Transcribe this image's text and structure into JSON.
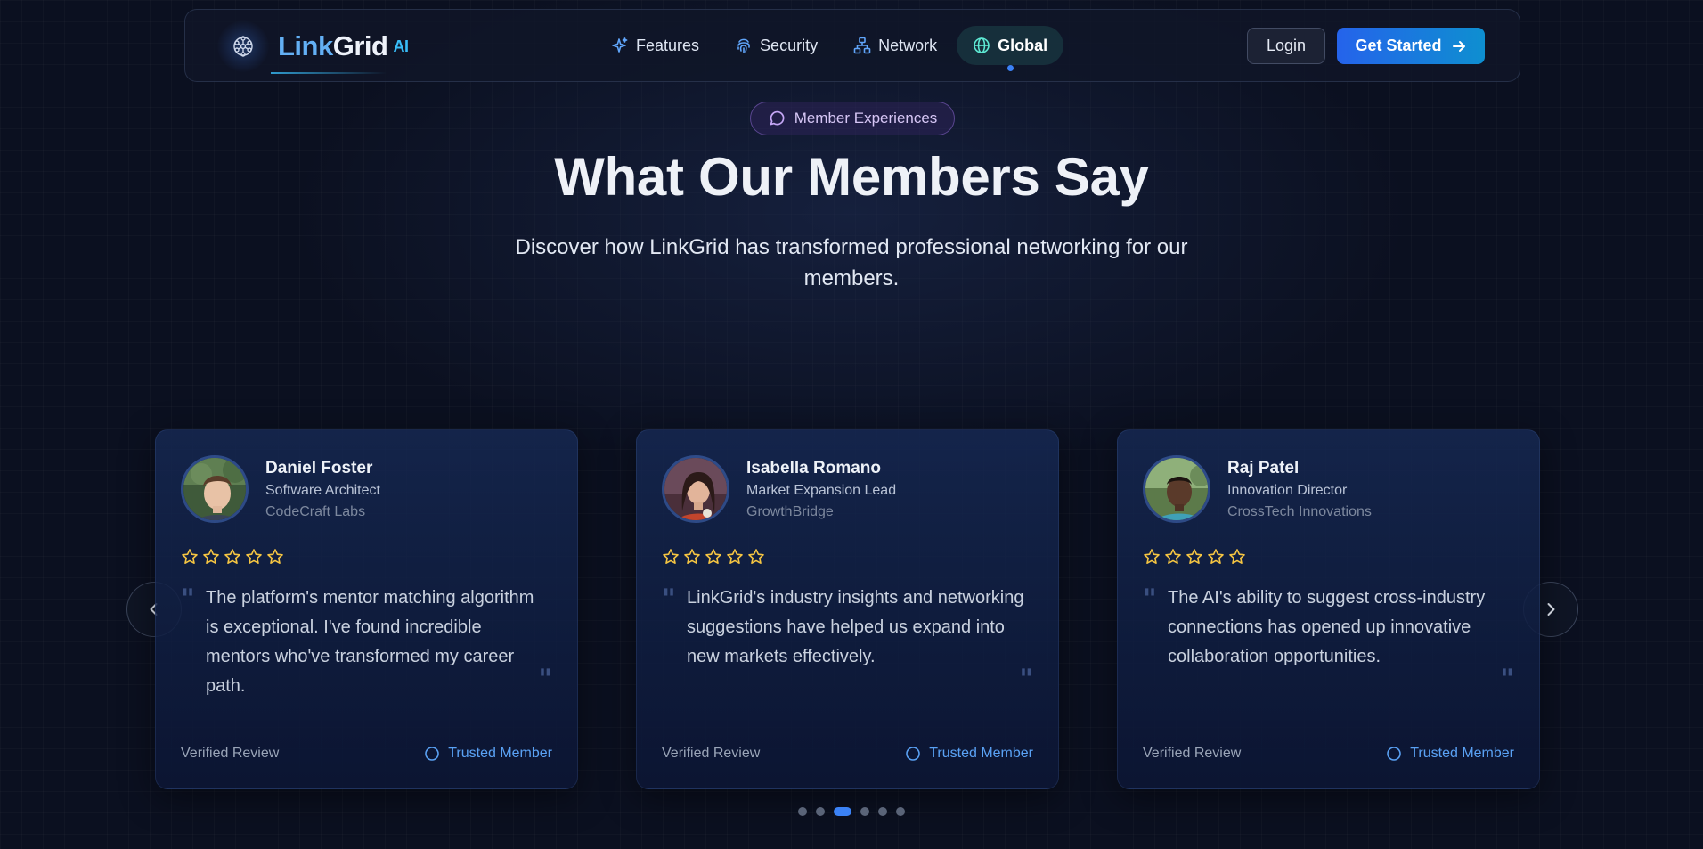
{
  "brand": {
    "name_part1": "Link",
    "name_part2": "Grid",
    "suffix": "AI"
  },
  "nav": {
    "items": [
      {
        "label": "Features",
        "icon": "sparkles-icon"
      },
      {
        "label": "Security",
        "icon": "fingerprint-icon"
      },
      {
        "label": "Network",
        "icon": "network-icon"
      },
      {
        "label": "Global",
        "icon": "globe-icon",
        "active": true
      }
    ],
    "login_label": "Login",
    "get_started_label": "Get Started"
  },
  "hero": {
    "badge": "Member Experiences",
    "title": "What Our Members Say",
    "subtitle": "Discover how LinkGrid has transformed professional networking for our members."
  },
  "testimonials": [
    {
      "name": "Daniel Foster",
      "role": "Software Architect",
      "company": "CodeCraft Labs",
      "rating": 5,
      "quote": "The platform's mentor matching algorithm is exceptional. I've found incredible mentors who've transformed my career path.",
      "verified_label": "Verified Review",
      "trusted_label": "Trusted Member"
    },
    {
      "name": "Isabella Romano",
      "role": "Market Expansion Lead",
      "company": "GrowthBridge",
      "rating": 5,
      "quote": "LinkGrid's industry insights and networking suggestions have helped us expand into new markets effectively.",
      "verified_label": "Verified Review",
      "trusted_label": "Trusted Member"
    },
    {
      "name": "Raj Patel",
      "role": "Innovation Director",
      "company": "CrossTech Innovations",
      "rating": 5,
      "quote": "The AI's ability to suggest cross-industry connections has opened up innovative collaboration opportunities.",
      "verified_label": "Verified Review",
      "trusted_label": "Trusted Member"
    }
  ],
  "carousel": {
    "page_count": 6,
    "active_index": 2
  },
  "colors": {
    "accent": "#3b82f6",
    "star": "#f5c542",
    "background": "#0b1020"
  }
}
